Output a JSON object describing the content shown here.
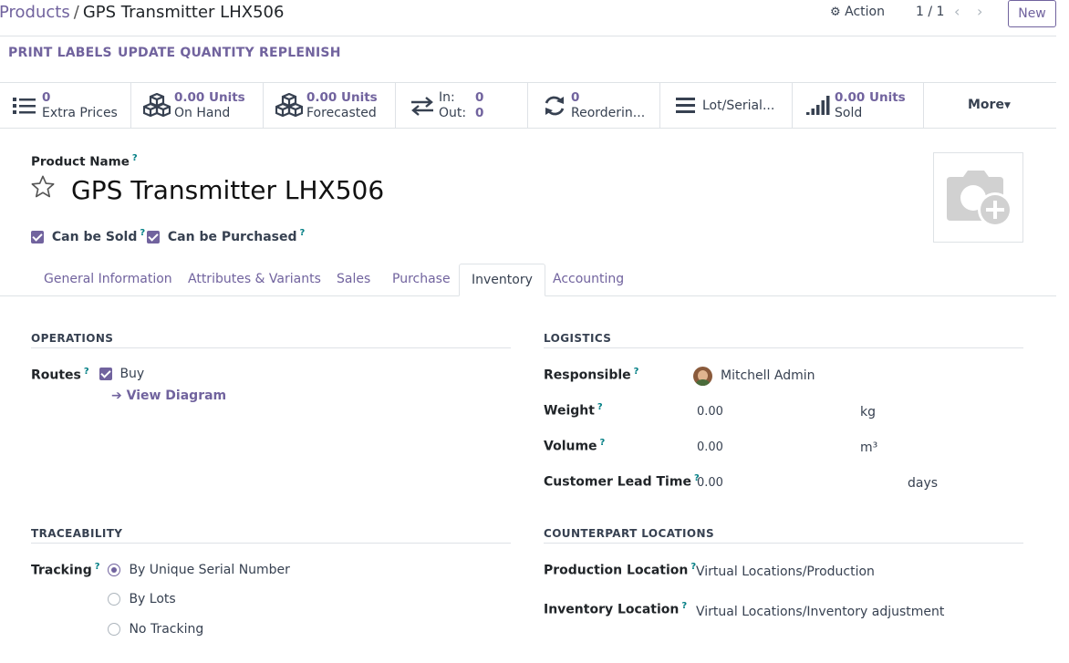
{
  "breadcrumb": {
    "parent": "Products",
    "separator": "/",
    "current": "GPS Transmitter LHX506"
  },
  "control": {
    "action_label": "Action",
    "pager": "1 / 1",
    "new_label": "New"
  },
  "header_buttons": [
    "PRINT LABELS",
    "UPDATE QUANTITY",
    "REPLENISH"
  ],
  "smart_buttons": {
    "extra_prices": {
      "value": "0",
      "label": "Extra Prices",
      "icon": "list-icon"
    },
    "on_hand": {
      "value": "0.00 Units",
      "label": "On Hand",
      "icon": "cubes-icon"
    },
    "forecasted": {
      "value": "0.00 Units",
      "label": "Forecasted",
      "icon": "cubes-icon"
    },
    "in_out": {
      "in_label": "In:",
      "in_value": "0",
      "out_label": "Out:",
      "out_value": "0",
      "icon": "exchange-icon"
    },
    "reordering": {
      "value": "0",
      "label": "Reorderin...",
      "icon": "refresh-icon"
    },
    "lot_serial": {
      "label": "Lot/Serial...",
      "icon": "bars-icon"
    },
    "sold": {
      "value": "0.00 Units",
      "label": "Sold",
      "icon": "signal-icon"
    },
    "more": {
      "label": "More"
    }
  },
  "product": {
    "name_label": "Product Name",
    "name": "GPS Transmitter LHX506",
    "help_mark": "?",
    "can_be_sold": "Can be Sold",
    "can_be_purchased": "Can be Purchased"
  },
  "tabs": [
    "General Information",
    "Attributes & Variants",
    "Sales",
    "Purchase",
    "Inventory",
    "Accounting"
  ],
  "active_tab": "Inventory",
  "operations": {
    "title": "OPERATIONS",
    "routes_label": "Routes",
    "route_buy": "Buy",
    "view_diagram": "View Diagram"
  },
  "logistics": {
    "title": "LOGISTICS",
    "responsible_label": "Responsible",
    "responsible": "Mitchell Admin",
    "weight_label": "Weight",
    "weight": "0.00",
    "weight_unit": "kg",
    "volume_label": "Volume",
    "volume": "0.00",
    "volume_unit": "m³",
    "lead_time_label": "Customer Lead Time",
    "lead_time": "0.00",
    "lead_time_unit": "days"
  },
  "traceability": {
    "title": "TRACEABILITY",
    "tracking_label": "Tracking",
    "options": [
      "By Unique Serial Number",
      "By Lots",
      "No Tracking"
    ],
    "selected": "By Unique Serial Number"
  },
  "counterpart": {
    "title": "COUNTERPART LOCATIONS",
    "production_label": "Production Location",
    "production": "Virtual Locations/Production",
    "inventory_label": "Inventory Location",
    "inventory": "Virtual Locations/Inventory adjustment"
  },
  "colors": {
    "accent": "#71639e",
    "help": "#017e84",
    "border": "#dee2e6"
  }
}
